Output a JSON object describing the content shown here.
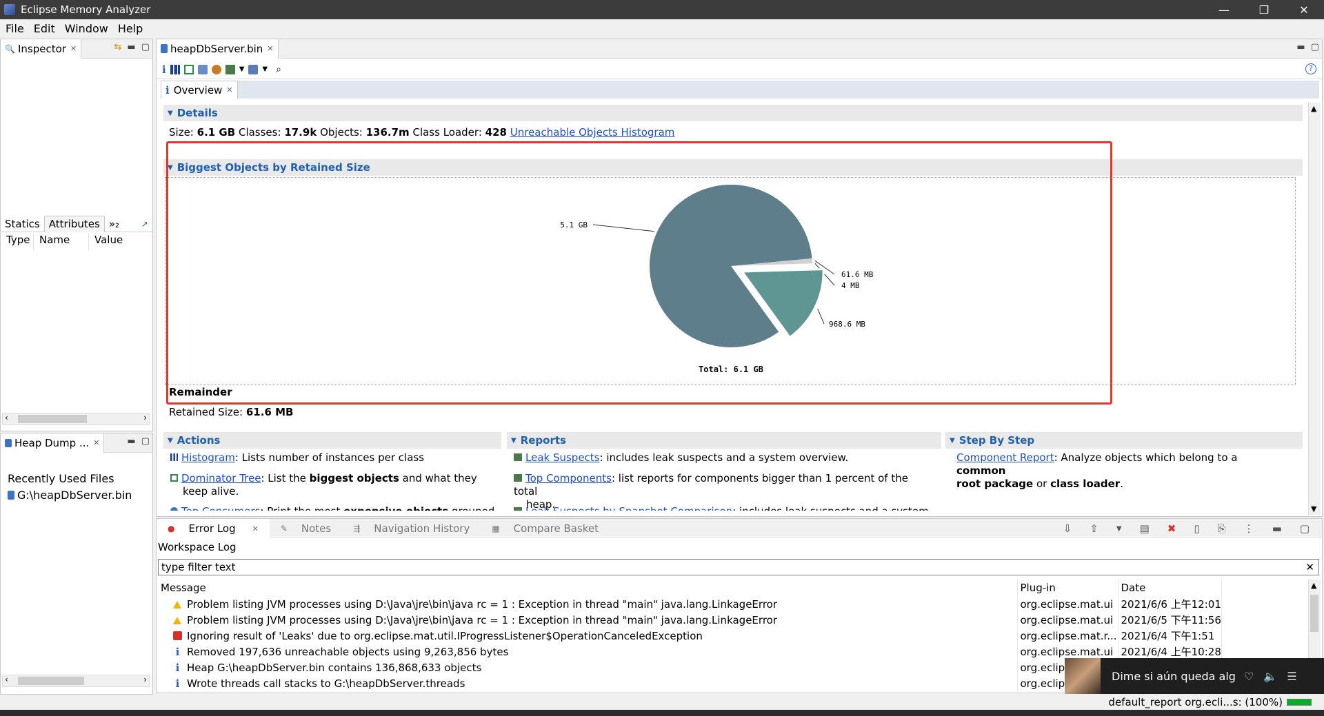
{
  "window": {
    "title": "Eclipse Memory Analyzer",
    "minimize": "—",
    "restore": "❐",
    "close": "✕"
  },
  "menu": [
    "File",
    "Edit",
    "Window",
    "Help"
  ],
  "inspector": {
    "tab": "Inspector",
    "subtabs": [
      "Statics",
      "Attributes",
      "»₂"
    ],
    "columns": [
      "Type",
      "Name",
      "Value"
    ]
  },
  "heapdump": {
    "tab": "Heap Dump ...",
    "recent_label": "Recently Used Files",
    "file": "G:\\heapDbServer.bin"
  },
  "editor": {
    "tab": "heapDbServer.bin",
    "inner_tab": "Overview",
    "details_header": "Details",
    "details": {
      "size_label": "Size:",
      "size": "6.1 GB",
      "classes_label": "Classes:",
      "classes": "17.9k",
      "objects_label": "Objects:",
      "objects": "136.7m",
      "loader_label": "Class Loader:",
      "loader": "428",
      "link": "Unreachable Objects Histogram"
    },
    "biggest_header": "Biggest Objects by Retained Size",
    "remainder_label": "Remainder",
    "retained_label": "Retained Size:",
    "retained_value": "61.6 MB",
    "actions_header": "Actions",
    "reports_header": "Reports",
    "step_header": "Step By Step",
    "actions": [
      {
        "link": "Histogram",
        "text": ": Lists number of instances per class"
      },
      {
        "link": "Dominator Tree",
        "text_a": ": List the ",
        "bold": "biggest objects",
        "text_b": " and what they",
        "text_c": "keep alive."
      },
      {
        "link": "Top Consumers",
        "text_a": ": Print the most ",
        "bold": "expensive objects",
        "text_b": " grouped"
      }
    ],
    "reports": [
      {
        "link": "Leak Suspects",
        "text": ": includes leak suspects and a system overview."
      },
      {
        "link": "Top Components",
        "text": ": list reports for components bigger than 1 percent of the total",
        "text2": "heap."
      },
      {
        "link": "Leak Suspects by Snapshot Comparison",
        "text": ": includes leak suspects and a system"
      }
    ],
    "step": {
      "link": "Component Report",
      "text_a": ": Analyze objects which belong to a ",
      "bold_a": "common",
      "bold_b": "root package",
      "text_b": " or ",
      "bold_c": "class loader",
      "text_c": "."
    }
  },
  "chart_data": {
    "type": "pie",
    "labels": [
      "5.1 GB",
      "61.6 MB",
      "4 MB",
      "968.6 MB"
    ],
    "values_mb": [
      5222.4,
      61.6,
      4,
      968.6
    ],
    "colors": [
      "#5f7e8c",
      "#d0d0d0",
      "#e8e8e8",
      "#5f9694"
    ],
    "total_label": "Total: 6.1 GB"
  },
  "errlog": {
    "tabs": [
      "Error Log",
      "Notes",
      "Navigation History",
      "Compare Basket"
    ],
    "workspace": "Workspace Log",
    "filter_placeholder": "type filter text",
    "columns": [
      "Message",
      "Plug-in",
      "Date"
    ],
    "rows": [
      {
        "type": "warn",
        "message": "Problem listing JVM processes using D:\\Java\\jre\\bin\\java rc = 1 : Exception in thread \"main\" java.lang.LinkageError",
        "plugin": "org.eclipse.mat.ui",
        "date": "2021/6/6 上午12:01"
      },
      {
        "type": "warn",
        "message": "Problem listing JVM processes using D:\\Java\\jre\\bin\\java rc = 1 : Exception in thread \"main\" java.lang.LinkageError",
        "plugin": "org.eclipse.mat.ui",
        "date": "2021/6/5 下午11:56"
      },
      {
        "type": "err",
        "message": "Ignoring result of 'Leaks' due to org.eclipse.mat.util.IProgressListener$OperationCanceledException",
        "plugin": "org.eclipse.mat.r...",
        "date": "2021/6/4 下午1:51"
      },
      {
        "type": "info",
        "message": "Removed 197,636 unreachable objects using 9,263,856 bytes",
        "plugin": "org.eclipse.mat.ui",
        "date": "2021/6/4 上午10:28"
      },
      {
        "type": "info",
        "message": "Heap G:\\heapDbServer.bin contains 136,868,633 objects",
        "plugin": "org.eclips",
        "date": ""
      },
      {
        "type": "info",
        "message": "Wrote threads call stacks to G:\\heapDbServer.threads",
        "plugin": "org.eclips",
        "date": ""
      }
    ]
  },
  "status": {
    "text": "default_report  org.ecli...s: (100%)",
    "progress": 1.0
  },
  "media": {
    "text": "Dime si aún queda algo e"
  }
}
